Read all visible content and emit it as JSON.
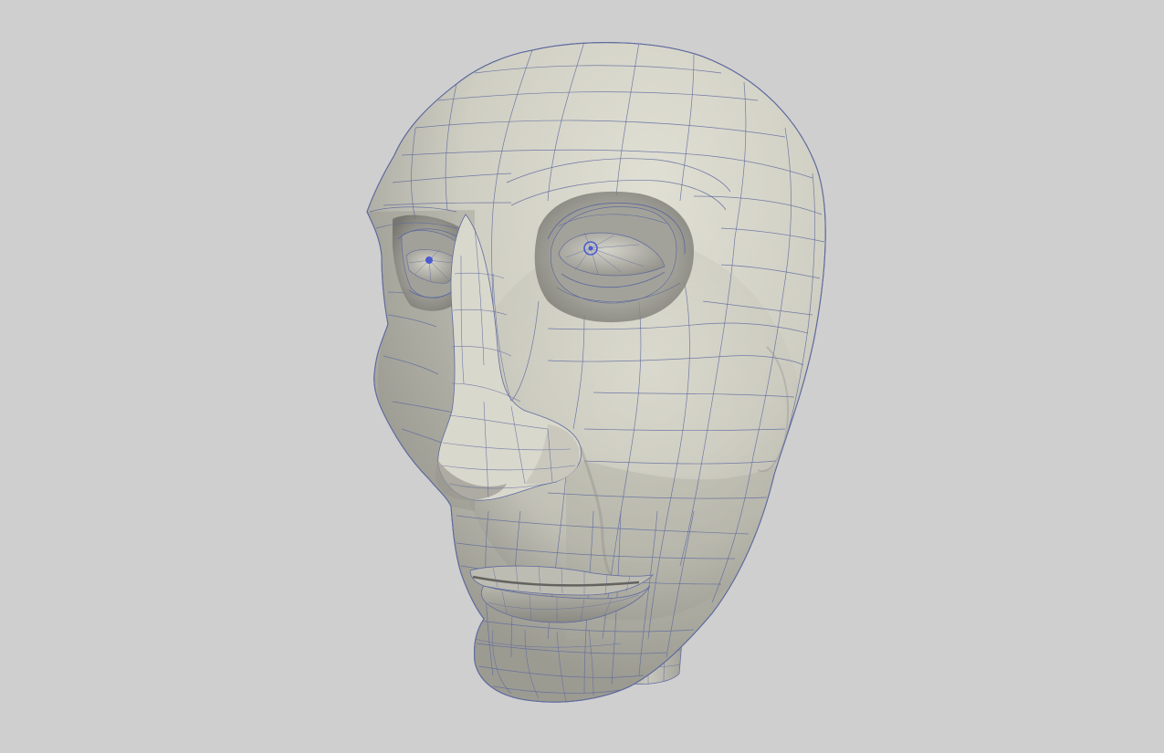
{
  "scene": {
    "background_color": "#cfcfcf",
    "subject": "head-mesh",
    "surface_color": "#d8d7cc",
    "shadow_color": "#8d8d86",
    "wireframe_color": "#5f6b9e",
    "iris_color": "#4a5bd0",
    "render_style": "smooth-shaded-with-wireframe-overlay"
  }
}
